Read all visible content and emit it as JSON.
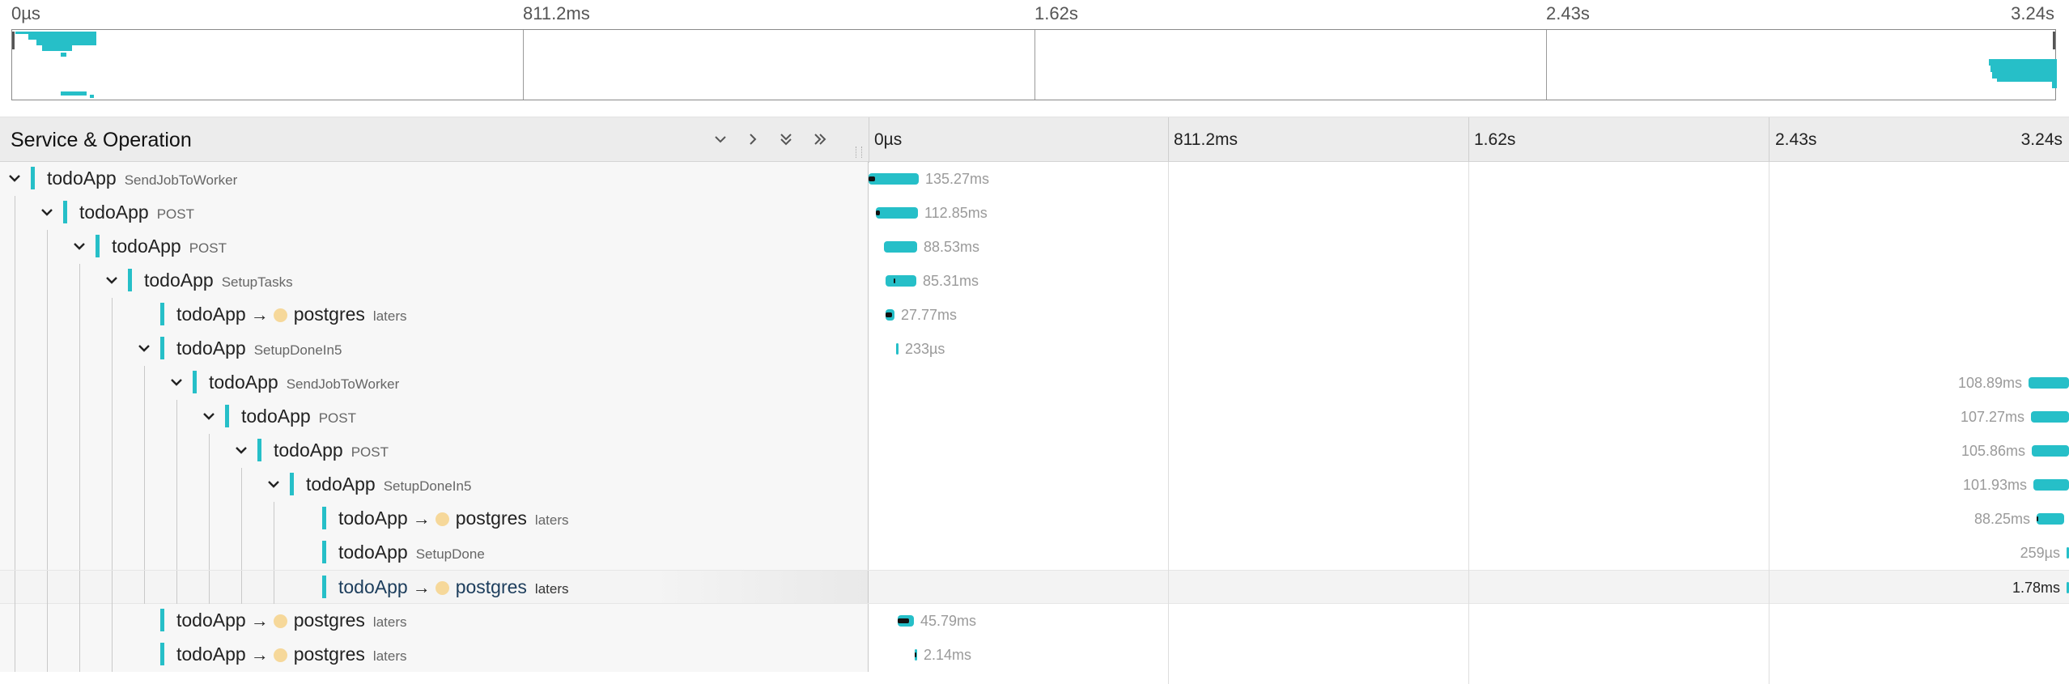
{
  "minimap": {
    "ticks": [
      "0µs",
      "811.2ms",
      "1.62s",
      "2.43s",
      "3.24s"
    ]
  },
  "header": {
    "title": "Service & Operation",
    "buttons": [
      "collapse-one",
      "expand-one",
      "collapse-all",
      "expand-all"
    ],
    "ticks": [
      "0µs",
      "811.2ms",
      "1.62s",
      "2.43s",
      "3.24s"
    ]
  },
  "rows": [
    {
      "service": "todoApp",
      "operation": "SendJobToWorker",
      "duration": "135.27ms",
      "depth": 0,
      "expandable": true
    },
    {
      "service": "todoApp",
      "operation": "POST",
      "duration": "112.85ms",
      "depth": 1,
      "expandable": true
    },
    {
      "service": "todoApp",
      "operation": "POST",
      "duration": "88.53ms",
      "depth": 2,
      "expandable": true
    },
    {
      "service": "todoApp",
      "operation": "SetupTasks",
      "duration": "85.31ms",
      "depth": 3,
      "expandable": true
    },
    {
      "service": "todoApp",
      "arrow": "→",
      "peer": "postgres",
      "operation": "laters",
      "duration": "27.77ms",
      "depth": 4,
      "expandable": false
    },
    {
      "service": "todoApp",
      "operation": "SetupDoneIn5",
      "duration": "233µs",
      "depth": 4,
      "expandable": true
    },
    {
      "service": "todoApp",
      "operation": "SendJobToWorker",
      "duration": "108.89ms",
      "depth": 5,
      "expandable": true
    },
    {
      "service": "todoApp",
      "operation": "POST",
      "duration": "107.27ms",
      "depth": 6,
      "expandable": true
    },
    {
      "service": "todoApp",
      "operation": "POST",
      "duration": "105.86ms",
      "depth": 7,
      "expandable": true
    },
    {
      "service": "todoApp",
      "operation": "SetupDoneIn5",
      "duration": "101.93ms",
      "depth": 8,
      "expandable": true
    },
    {
      "service": "todoApp",
      "arrow": "→",
      "peer": "postgres",
      "operation": "laters",
      "duration": "88.25ms",
      "depth": 9,
      "expandable": false
    },
    {
      "service": "todoApp",
      "operation": "SetupDone",
      "duration": "259µs",
      "depth": 9,
      "expandable": false
    },
    {
      "service": "todoApp",
      "arrow": "→",
      "peer": "postgres",
      "operation": "laters",
      "duration": "1.78ms",
      "depth": 9,
      "expandable": false,
      "selected": true
    },
    {
      "service": "todoApp",
      "arrow": "→",
      "peer": "postgres",
      "operation": "laters",
      "duration": "45.79ms",
      "depth": 4,
      "expandable": false
    },
    {
      "service": "todoApp",
      "arrow": "→",
      "peer": "postgres",
      "operation": "laters",
      "duration": "2.14ms",
      "depth": 4,
      "expandable": false
    }
  ],
  "colors": {
    "span": "#26bfc8",
    "peer_dot": "#f6d89a"
  }
}
